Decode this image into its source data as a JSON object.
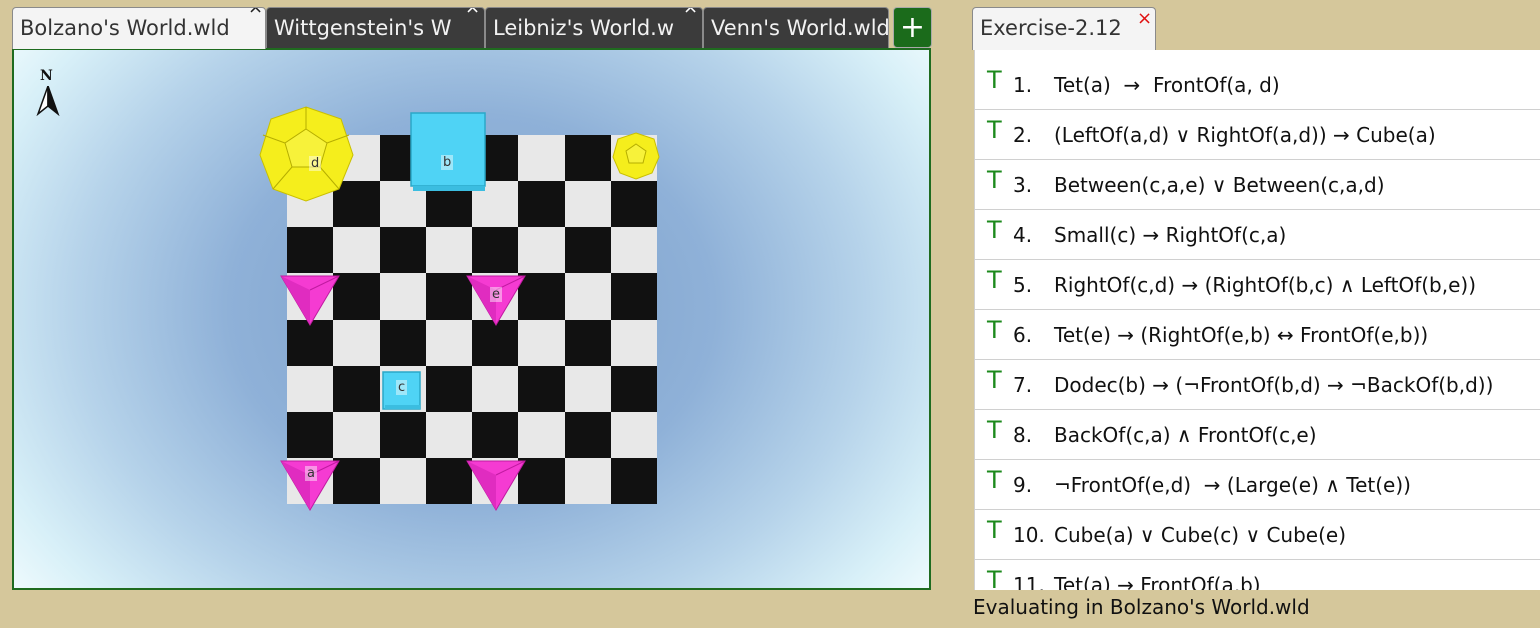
{
  "world_tabs": [
    {
      "label": "Bolzano's World.wld",
      "active": true
    },
    {
      "label": "Wittgenstein's W",
      "active": false
    },
    {
      "label": "Leibniz's World.w",
      "active": false
    },
    {
      "label": "Venn's World.wld",
      "active": false
    }
  ],
  "tab_close_glyph": "×",
  "add_tab_label": "+",
  "compass_label": "N",
  "objects": [
    {
      "name": "d",
      "shape": "dodec",
      "size": "large",
      "color": "#f5ee1c"
    },
    {
      "name": "b",
      "shape": "cube",
      "size": "large",
      "color": "#4fd3f5"
    },
    {
      "name": "c",
      "shape": "cube",
      "size": "small",
      "color": "#4fd3f5"
    },
    {
      "name": "e",
      "shape": "tet",
      "size": "medium",
      "color": "#f53bd2"
    },
    {
      "name": "a",
      "shape": "tet",
      "size": "medium",
      "color": "#f53bd2"
    }
  ],
  "exercise": {
    "tab_label": "Exercise-2.12",
    "close_glyph": "×",
    "sentences": [
      {
        "truth": "T",
        "num": "1.",
        "formula": "Tet(a)  →  FrontOf(a, d)"
      },
      {
        "truth": "T",
        "num": "2.",
        "formula": "(LeftOf(a,d) ∨ RightOf(a,d)) → Cube(a)"
      },
      {
        "truth": "T",
        "num": "3.",
        "formula": "Between(c,a,e) ∨ Between(c,a,d)"
      },
      {
        "truth": "T",
        "num": "4.",
        "formula": "Small(c) → RightOf(c,a)"
      },
      {
        "truth": "T",
        "num": "5.",
        "formula": "RightOf(c,d) → (RightOf(b,c) ∧ LeftOf(b,e))"
      },
      {
        "truth": "T",
        "num": "6.",
        "formula": "Tet(e) → (RightOf(e,b) ↔ FrontOf(e,b))"
      },
      {
        "truth": "T",
        "num": "7.",
        "formula": "Dodec(b) → (¬FrontOf(b,d) → ¬BackOf(b,d))"
      },
      {
        "truth": "T",
        "num": "8.",
        "formula": "BackOf(c,a) ∧ FrontOf(c,e)"
      },
      {
        "truth": "T",
        "num": "9.",
        "formula": "¬FrontOf(e,d)  → (Large(e) ∧ Tet(e))"
      },
      {
        "truth": "T",
        "num": "10.",
        "formula": "Cube(a) ∨ Cube(c) ∨ Cube(e)"
      },
      {
        "truth": "T",
        "num": "11.",
        "formula": "Tet(a) → FrontOf(a,b)"
      }
    ],
    "status": "Evaluating in Bolzano's World.wld"
  },
  "colors": {
    "truth_true": "#1c8a1c",
    "add_button": "#1b6b1b",
    "frame": "#d5c79b"
  }
}
